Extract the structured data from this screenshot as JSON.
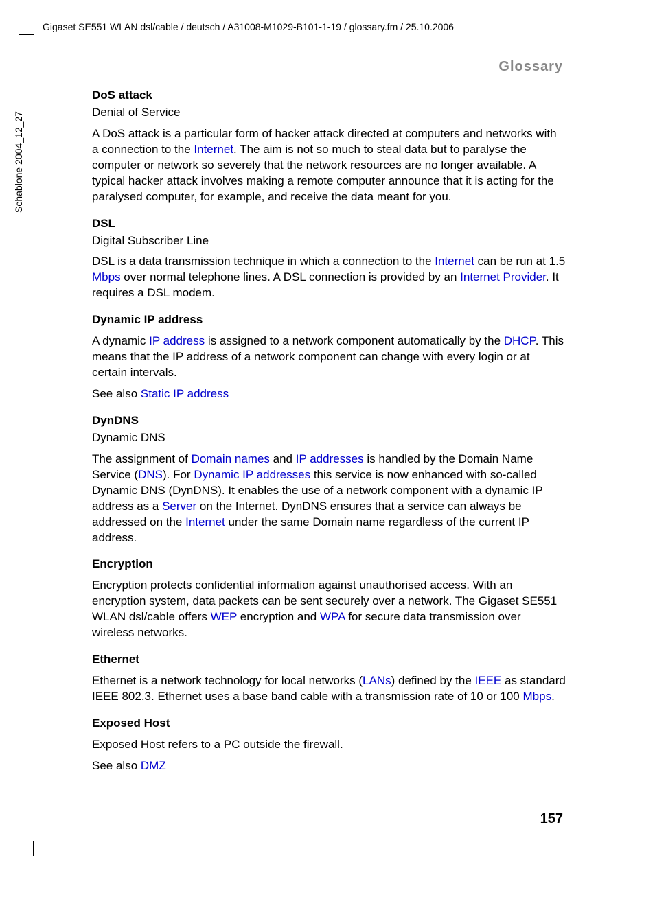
{
  "header": "Gigaset SE551 WLAN dsl/cable / deutsch / A31008-M1029-B101-1-19 / glossary.fm / 25.10.2006",
  "sideText": "Schablone 2004_12_27",
  "sectionTitle": "Glossary",
  "pageNumber": "157",
  "t1": {
    "term": "DoS attack",
    "sub": "Denial of Service",
    "p1a": "A DoS attack is a particular form of hacker attack directed at computers and networks with a connection to the ",
    "l1": "Internet",
    "p1b": ". The aim is not so much to steal data but to paralyse the computer or network so severely that the network resources are no longer available. A typical hacker attack involves making a remote computer announce that it is acting for the paralysed computer, for example, and receive the data meant for you."
  },
  "t2": {
    "term": "DSL",
    "sub": "Digital Subscriber Line",
    "p1a": "DSL is a data transmission technique in which a connection to the ",
    "l1": "Internet",
    "p1b": " can be run at 1.5 ",
    "l2": "Mbps",
    "p1c": " over normal telephone lines. A DSL connection is provided by an ",
    "l3": "Internet Provider",
    "p1d": ". It requires a DSL modem."
  },
  "t3": {
    "term": "Dynamic IP address",
    "p1a": "A dynamic ",
    "l1": "IP address",
    "p1b": " is assigned to a network component automatically by the ",
    "l2": "DHCP",
    "p1c": ". This means that the IP address of a network component can change with every login or at certain intervals.",
    "p2a": "See also ",
    "l3": "Static IP address"
  },
  "t4": {
    "term": "DynDNS",
    "sub": "Dynamic DNS",
    "p1a": "The assignment of ",
    "l1": "Domain names",
    "p1b": " and ",
    "l2": "IP addresses",
    "p1c": " is handled by the Domain Name Service (",
    "l3": "DNS",
    "p1d": "). For ",
    "l4": "Dynamic IP addresses",
    "p1e": " this service is now enhanced with so-called Dynamic DNS (DynDNS). It enables the use of a network component with a dynamic IP address as a ",
    "l5": "Server",
    "p1f": " on the Internet. DynDNS ensures that a service can always be addressed on the ",
    "l6": "Internet",
    "p1g": " under the same Domain name regardless of the current IP address."
  },
  "t5": {
    "term": "Encryption",
    "p1a": "Encryption protects confidential information against unauthorised access. With an encryption system, data packets can be sent securely over a network. The Gigaset SE551 WLAN dsl/cable offers ",
    "l1": "WEP",
    "p1b": " encryption and ",
    "l2": "WPA",
    "p1c": " for secure data transmission over wireless networks."
  },
  "t6": {
    "term": "Ethernet",
    "p1a": "Ethernet is a network technology for local networks (",
    "l1": "LANs",
    "p1b": ") defined by the ",
    "l2": "IEEE",
    "p1c": " as standard IEEE 802.3. Ethernet uses a base band cable with a transmission rate of 10 or 100 ",
    "l3": "Mbps",
    "p1d": "."
  },
  "t7": {
    "term": "Exposed Host",
    "p1a": "Exposed Host refers to a PC outside the firewall.",
    "p2a": "See also ",
    "l1": "DMZ"
  }
}
